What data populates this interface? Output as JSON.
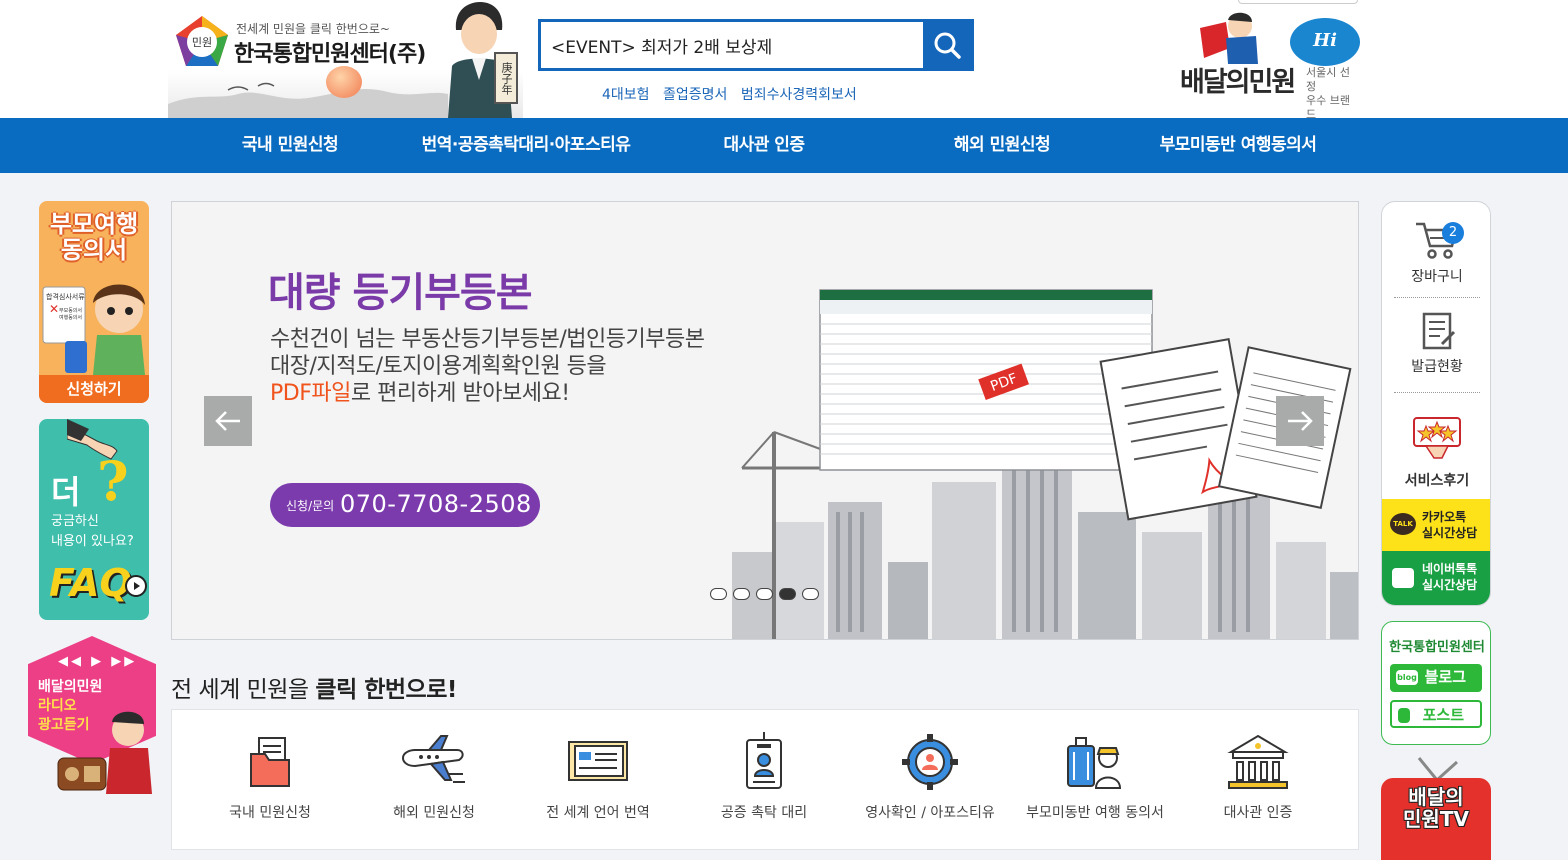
{
  "header": {
    "logo": {
      "badge_text": "민원",
      "tagline": "전세계 민원을 클릭 한번으로~",
      "name": "한국통합민원센터(주)",
      "stamp": "庚子年"
    },
    "search": {
      "value": "<EVENT> 최저가 2배 보상제",
      "button_icon": "search-icon"
    },
    "quick_links": [
      "4대보험",
      "졸업증명서",
      "범죄수사경력회보서"
    ],
    "brand": {
      "name": "배달의민원",
      "hiseoul": "Hi Seoul",
      "sub_line1": "서울시 선정",
      "sub_line2": "우수 브랜드"
    }
  },
  "nav": {
    "items": [
      "국내 민원신청",
      "번역·공증촉탁대리·아포스티유",
      "대사관 인증",
      "해외 민원신청",
      "부모미동반 여행동의서"
    ]
  },
  "left_ads": {
    "consent": {
      "title_line1": "부모여행",
      "title_line2": "동의서",
      "button": "신청하기",
      "doc_line1": "합격심사서류",
      "doc_line2": "부모동의서",
      "doc_line3": "여행동의서"
    },
    "faq": {
      "big": "더",
      "question": "?",
      "line1": "궁금하신",
      "line2": "내용이 있나요?",
      "faq": "FAQ"
    },
    "radio": {
      "controls": "◀◀ ▶ ▶▶",
      "line1": "배달의민원",
      "line2": "라디오",
      "line3": "광고듣기"
    }
  },
  "banner": {
    "headline": "대량 등기부등본",
    "desc_line1": "수천건이 넘는 부동산등기부등본/법인등기부등본",
    "desc_line2": "대장/지적도/토지이용계획확인원 등을",
    "desc_line3_highlight": "PDF파일",
    "desc_line3_rest": "로 편리하게 받아보세요!",
    "contact_label": "신청/문의",
    "contact_number": "070-7708-2508",
    "pdf_tag": "PDF",
    "slides_total": 5,
    "active_slide": 4,
    "accent_color": "#7b3bac"
  },
  "services": {
    "title_plain": "전 세계 민원을 ",
    "title_bold": "클릭 한번으로!",
    "items": [
      {
        "label": "국내 민원신청",
        "icon": "folder-document-icon"
      },
      {
        "label": "해외 민원신청",
        "icon": "airplane-icon"
      },
      {
        "label": "전 세계 언어 번역",
        "icon": "translation-document-icon"
      },
      {
        "label": "공증 촉탁 대리",
        "icon": "id-badge-icon"
      },
      {
        "label": "영사확인 / 아포스티유",
        "icon": "gear-person-icon"
      },
      {
        "label": "부모미동반 여행 동의서",
        "icon": "luggage-traveler-icon"
      },
      {
        "label": "대사관 인증",
        "icon": "embassy-building-icon"
      }
    ]
  },
  "right_menu": {
    "cart": {
      "label": "장바구니",
      "count": "2"
    },
    "issue": {
      "label": "발급현황"
    },
    "review": {
      "label": "서비스후기"
    },
    "kakao": {
      "line1": "카카오톡",
      "line2": "실시간상담",
      "icon_text": "TALK"
    },
    "naver": {
      "line1": "네이버톡톡",
      "line2": "실시간상담"
    },
    "blog": {
      "header": "한국통합민원센터",
      "blog": "블로그",
      "post": "포스트",
      "blog_icon_text": "blog"
    },
    "tv": {
      "line1": "배달의",
      "line2": "민원TV"
    }
  }
}
